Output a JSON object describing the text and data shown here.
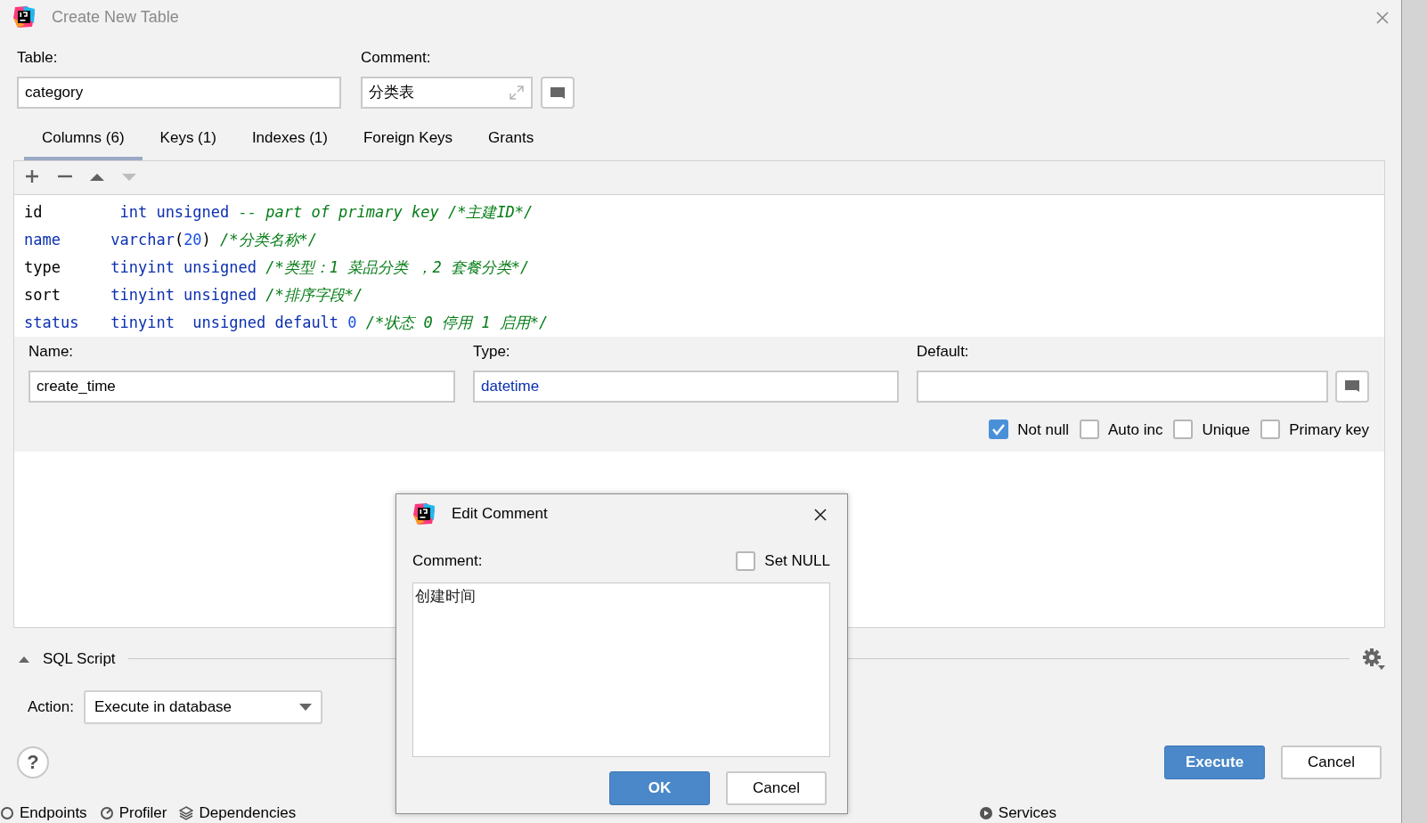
{
  "window": {
    "title": "Create New Table"
  },
  "table_field": {
    "label": "Table:",
    "value": "category"
  },
  "comment_field": {
    "label": "Comment:",
    "value": "分类表"
  },
  "tabs": [
    {
      "label": "Columns (6)",
      "selected": true
    },
    {
      "label": "Keys (1)",
      "selected": false
    },
    {
      "label": "Indexes (1)",
      "selected": false
    },
    {
      "label": "Foreign Keys",
      "selected": false
    },
    {
      "label": "Grants",
      "selected": false
    }
  ],
  "toolbar": [
    {
      "kind": "add",
      "disabled": false
    },
    {
      "kind": "remove",
      "disabled": false
    },
    {
      "kind": "up",
      "disabled": false
    },
    {
      "kind": "down",
      "disabled": true
    }
  ],
  "code_lines": [
    {
      "name": {
        "kind": "ident",
        "text": "id"
      },
      "tokens": [
        {
          "kind": "keyword",
          "text": " int unsigned"
        },
        {
          "kind": "comment",
          "text": " -- part of primary key /*主建ID*/"
        }
      ]
    },
    {
      "name": {
        "kind": "keyword",
        "text": "name"
      },
      "tokens": [
        {
          "kind": "keyword",
          "text": "varchar"
        },
        {
          "kind": "punct",
          "text": "("
        },
        {
          "kind": "number",
          "text": "20"
        },
        {
          "kind": "punct",
          "text": ")"
        },
        {
          "kind": "comment",
          "text": " /*分类名称*/"
        }
      ]
    },
    {
      "name": {
        "kind": "ident",
        "text": "type"
      },
      "tokens": [
        {
          "kind": "keyword",
          "text": "tinyint unsigned"
        },
        {
          "kind": "comment",
          "text": " /*类型：1 菜品分类 ，2 套餐分类*/"
        }
      ]
    },
    {
      "name": {
        "kind": "ident",
        "text": "sort"
      },
      "tokens": [
        {
          "kind": "keyword",
          "text": "tinyint unsigned"
        },
        {
          "kind": "comment",
          "text": " /*排序字段*/"
        }
      ]
    },
    {
      "name": {
        "kind": "keyword",
        "text": "status"
      },
      "tokens": [
        {
          "kind": "keyword",
          "text": "tinyint  unsigned default"
        },
        {
          "kind": "number",
          "text": " 0"
        },
        {
          "kind": "comment",
          "text": " /*状态 0 停用 1 启用*/"
        }
      ]
    }
  ],
  "column_editor": {
    "name": {
      "label": "Name:",
      "value": "create_time"
    },
    "type": {
      "label": "Type:",
      "value": "datetime"
    },
    "default": {
      "label": "Default:"
    },
    "options": [
      {
        "label": "Not null",
        "checked": true
      },
      {
        "label": "Auto inc",
        "checked": false
      },
      {
        "label": "Unique",
        "checked": false
      },
      {
        "label": "Primary key",
        "checked": false
      }
    ]
  },
  "sql_script": {
    "title": "SQL Script"
  },
  "action": {
    "label": "Action:",
    "value": "Execute in database"
  },
  "help_button": "?",
  "buttons": [
    {
      "label": "Execute",
      "primary": true
    },
    {
      "label": "Cancel",
      "primary": false
    }
  ],
  "tool_windows": [
    {
      "kind": "endpoints",
      "label": "Endpoints"
    },
    {
      "kind": "profiler",
      "label": "Profiler"
    },
    {
      "kind": "dependencies",
      "label": "Dependencies"
    },
    {
      "kind": "services",
      "label": "Services"
    }
  ],
  "dialog": {
    "title": "Edit Comment",
    "label": "Comment:",
    "set_null": {
      "label": "Set NULL",
      "checked": false
    },
    "value": "创建时间",
    "buttons": [
      {
        "label": "OK",
        "primary": true
      },
      {
        "label": "Cancel",
        "primary": false
      }
    ]
  }
}
